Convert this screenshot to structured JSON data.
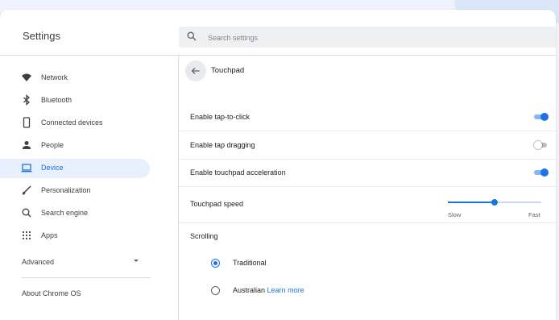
{
  "header": {
    "title": "Settings",
    "search": {
      "placeholder": "Search settings",
      "value": ""
    }
  },
  "sidebar": {
    "items": [
      {
        "label": "Network",
        "icon": "wifi-icon",
        "selected": false
      },
      {
        "label": "Bluetooth",
        "icon": "bluetooth-icon",
        "selected": false
      },
      {
        "label": "Connected devices",
        "icon": "phone-icon",
        "selected": false
      },
      {
        "label": "People",
        "icon": "person-icon",
        "selected": false
      },
      {
        "label": "Device",
        "icon": "laptop-icon",
        "selected": true
      },
      {
        "label": "Personalization",
        "icon": "brush-icon",
        "selected": false
      },
      {
        "label": "Search engine",
        "icon": "search-icon",
        "selected": false
      },
      {
        "label": "Apps",
        "icon": "apps-grid-icon",
        "selected": false
      }
    ],
    "advanced_label": "Advanced",
    "about_label": "About Chrome OS"
  },
  "main": {
    "title": "Touchpad",
    "settings": [
      {
        "label": "Enable tap-to-click",
        "on": true
      },
      {
        "label": "Enable tap dragging",
        "on": false
      },
      {
        "label": "Enable touchpad acceleration",
        "on": true
      }
    ],
    "speed": {
      "label": "Touchpad speed",
      "min_label": "Slow",
      "max_label": "Fast",
      "value_fraction": 0.5
    },
    "scrolling": {
      "title": "Scrolling",
      "options": [
        {
          "label": "Traditional",
          "checked": true
        },
        {
          "label": "Australian",
          "link": "Learn more",
          "checked": false
        }
      ]
    }
  },
  "colors": {
    "accent": "#1a73e8",
    "selected_bg": "#e8f0fe",
    "text": "#202124",
    "page_bg": "#eef3fd"
  }
}
